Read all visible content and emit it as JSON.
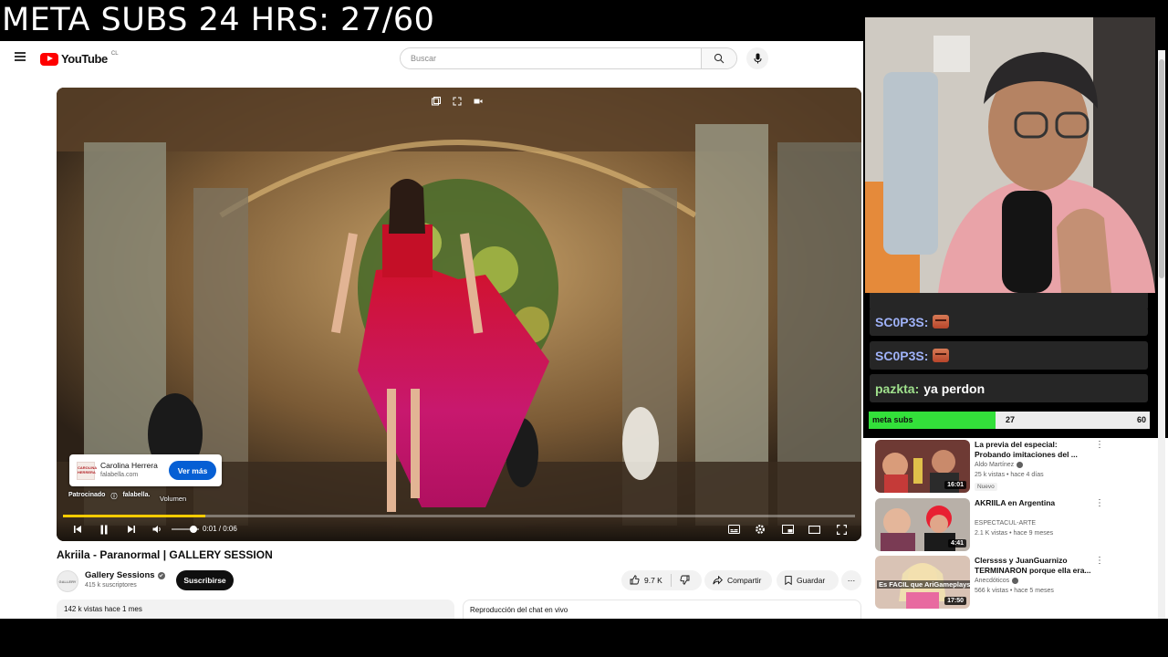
{
  "banner": {
    "text": "META  SUBS 24 HRS: 27/60"
  },
  "masthead": {
    "logo_text": "YouTube",
    "logo_country": "CL",
    "search_placeholder": "Buscar"
  },
  "player": {
    "ad": {
      "advertiser": "Carolina Herrera",
      "domain": "falabella.com",
      "cta": "Ver más",
      "logo_text": "CAROLINA HERRERA",
      "sponsored_label": "Patrocinado",
      "sponsor": "falabella."
    },
    "tooltip": "Volumen",
    "time": "0:01 / 0:06",
    "progress_fraction": 0.18,
    "volume_fraction": 0.7
  },
  "video": {
    "title": "Akriila - Paranormal | GALLERY SESSION",
    "channel": "Gallery Sessions",
    "avatar_text": "GALLERY",
    "subs": "415 k suscriptores",
    "subscribe_label": "Suscribirse",
    "likes": "9.7 K",
    "share_label": "Compartir",
    "save_label": "Guardar",
    "more_label": "⋯",
    "views": "142 k vistas  hace 1 mes",
    "chat_replay": "Reproducción del chat en vivo"
  },
  "chat": {
    "messages": [
      {
        "user": "SC0P3S:",
        "text": ""
      },
      {
        "user": "SC0P3S:",
        "text": ""
      },
      {
        "user": "pazkta:",
        "text": "ya perdon"
      }
    ]
  },
  "goal": {
    "label": "meta subs",
    "current": 27,
    "current_text": "27",
    "max": 60,
    "max_text": "60"
  },
  "recommendations": [
    {
      "title": "La previa del especial: Probando imitaciones del ...",
      "channel": "Aldo Martínez",
      "verified": true,
      "meta": "25 k vistas • hace 4 días",
      "duration": "16:01",
      "badge": "Nuevo"
    },
    {
      "title": "AKRIILA en Argentina",
      "channel": "ESPECTACUL-ARTE",
      "verified": false,
      "meta": "2.1 K vistas • hace 9 meses",
      "duration": "4:41",
      "badge": ""
    },
    {
      "title": "Clerssss y JuanGuarnizo TERMINARON porque ella era...",
      "channel": "Anecdóticos",
      "verified": true,
      "meta": "566 k vistas • hace 5 meses",
      "duration": "17:50",
      "badge": "",
      "thumb_text": "Es FACIL que AriGameplays"
    }
  ],
  "colors": {
    "accent": "#065fd4",
    "progress": "#ffcc00",
    "goal_fill": "#33e03a",
    "chat_user": "#9fb2f8",
    "chat_user_alt": "#9fe08c"
  }
}
